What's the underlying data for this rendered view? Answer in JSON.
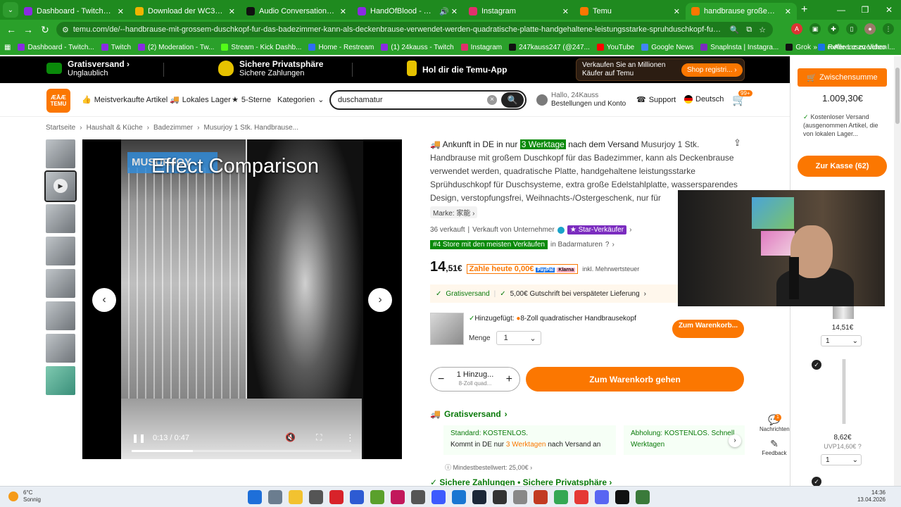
{
  "browser": {
    "tabs": [
      {
        "label": "Dashboard - TwitchTTS",
        "color": "#8a2be2",
        "active": false
      },
      {
        "label": "Download der WC3-Karte „Ani",
        "color": "#f0b400",
        "active": false
      },
      {
        "label": "Audio Conversation - Grok",
        "color": "#111111",
        "active": false
      },
      {
        "label": "HandOfBlood - Twitch",
        "color": "#8a2be2",
        "active": false
      },
      {
        "label": "Instagram",
        "color": "#e1306c",
        "active": false
      },
      {
        "label": "Temu",
        "color": "#fb7701",
        "active": false
      },
      {
        "label": "handbrause großem duschko",
        "color": "#fb7701",
        "active": true
      }
    ],
    "new_tab": "+",
    "url": "temu.com/de/--handbrause-mit-grossem-duschkopf-fur-das-badezimmer-kann-als-deckenbrause-verwendet-werden-quadratische-platte-handgehaltene-leistungsstarke-spruhduschkopf-fur-duschsysteme-extra-grosse-edelstahlpla...",
    "bookmarks": [
      {
        "label": "Dashboard - Twitch...",
        "color": "#8a2be2"
      },
      {
        "label": "Twitch",
        "color": "#8a2be2"
      },
      {
        "label": "(2) Moderation - Tw...",
        "color": "#8a2be2"
      },
      {
        "label": "Stream - Kick Dashb...",
        "color": "#53fc18"
      },
      {
        "label": "Home - Restream",
        "color": "#2f6df6"
      },
      {
        "label": "(1) 24kauss - Twitch",
        "color": "#8a2be2"
      },
      {
        "label": "Instagram",
        "color": "#e1306c"
      },
      {
        "label": "247kauss247 (@247...",
        "color": "#111111"
      },
      {
        "label": "YouTube",
        "color": "#ff0000"
      },
      {
        "label": "Google News",
        "color": "#4285f4"
      },
      {
        "label": "Snaplnsta | Instagra...",
        "color": "#7b2cbf"
      },
      {
        "label": "Grok",
        "color": "#111111"
      },
      {
        "label": "Referenz zu Video l...",
        "color": "#1a73e8"
      }
    ],
    "all_bookmarks": "Alle Lesezeichen"
  },
  "promo": {
    "free_shipping_title": "Gratisversand",
    "free_shipping_sub": "Unglaublich",
    "privacy_title": "Sichere Privatsphäre",
    "privacy_sub": "Sichere Zahlungen",
    "app": "Hol dir die Temu-App",
    "register_text": "Verkaufen Sie an Millionen Käufer auf Temu",
    "register_btn": "Shop registri..."
  },
  "header": {
    "logo_top": "ÆĀÆ",
    "logo_bottom": "TEMU",
    "nav": [
      "Meistverkaufte Artikel",
      "Lokales Lager",
      "5-Sterne",
      "Kategorien"
    ],
    "search_value": "duschamatur",
    "account_line1": "Hallo, 24Kauss",
    "account_line2": "Bestellungen und Konto",
    "support": "Support",
    "language": "Deutsch",
    "cart_badge": "99+"
  },
  "breadcrumb": [
    "Startseite",
    "Haushalt & Küche",
    "Badezimmer",
    "Musurjoy 1 Stk. Handbrause..."
  ],
  "video": {
    "title": "Effect Comparison",
    "brand_overlay": "MUSURJOY",
    "time": "0:13 / 0:47",
    "progress": 0.28
  },
  "product": {
    "arrival_prefix": "Ankunft in DE in nur",
    "arrival_days": "3 Werktage",
    "arrival_suffix": "nach dem Versand",
    "title": "Musurjoy 1 Stk. Handbrause mit großem Duschkopf für das Badezimmer, kann als Deckenbrause verwendet werden, quadratische Platte, handgehaltene leistungsstarke Sprühduschkopf für Duschsysteme, extra große Edelstahlplatte, wassersparendes Design, verstopfungsfrei, Weihnachts-/Ostergeschenk, nur für",
    "brand": "Marke: 家能 ›",
    "sold": "36 verkauft",
    "seller": "Verkauft von Unternehmer",
    "star_seller": "Star-Verkäufer",
    "rank_tag": "#4 Store mit den meisten Verkäufen",
    "rank_cat": "in Badarmaturen",
    "price_int": "14",
    "price_dec": ",51€",
    "pay_today": "Zahle heute 0,00€",
    "incl_tax": "inkl. Mehrwertsteuer",
    "free_ship": "Gratisversand",
    "credit": "5,00€ Gutschrift bei verspäteter Lieferung",
    "added_prefix": "Hinzugefügt:",
    "added_item": "8-Zoll quadratischer Handbrausekopf",
    "qty_label": "Menge",
    "qty_value": "1",
    "to_cart_small": "Zum Warenkorb...",
    "stepper_main": "1 Hinzug...",
    "stepper_sub": "8-Zoll quad...",
    "go_to_cart": "Zum Warenkorb gehen",
    "shipping_section": "Gratisversand",
    "standard_label": "Standard: KOSTENLOS.",
    "standard_line2_prefix": "Kommt in DE nur",
    "standard_days": "3 Werktagen",
    "standard_line2_suffix": "nach Versand an",
    "pickup_label": "Abholung: KOSTENLOS. Schnell",
    "pickup_line2": "Werktagen",
    "min_order": "Mindestbestellwert: 25,00€ ›",
    "secure_pay": "Sichere Zahlungen • Sichere Privatsphäre ›"
  },
  "float_icons": {
    "messages": "Nachrichten",
    "messages_badge": "1",
    "feedback": "Feedback"
  },
  "sidecart": {
    "subtotal_label": "Zwischensumme",
    "subtotal_value": "1.009,30€",
    "free_ship_note": "Kostenloser Versand (ausgenommen Artikel, die von lokalen Lager...",
    "checkout": "Zur Kasse (62)",
    "item1_price": "14,51€",
    "item1_qty": "1",
    "item2_price": "8,62€",
    "item2_uvp": "UVP14,60€",
    "item2_qty": "1"
  },
  "taskbar": {
    "temp": "6°C",
    "weather": "Sonnig",
    "time": "14:36",
    "date": "13.04.2026"
  }
}
